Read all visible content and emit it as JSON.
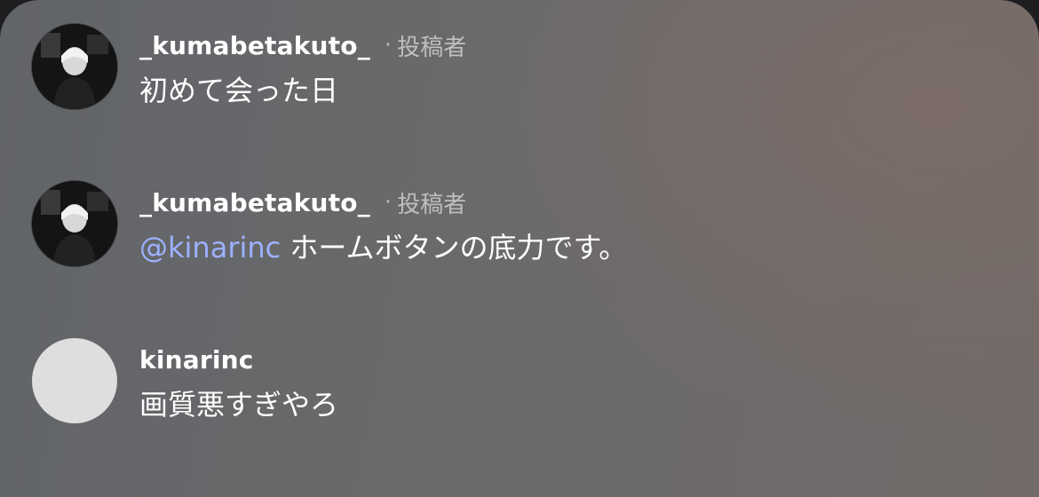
{
  "comments": [
    {
      "username": "_kumabetakuto_",
      "separator": "·",
      "badge": "投稿者",
      "text": "初めて会った日",
      "avatar": "user-photo"
    },
    {
      "username": "_kumabetakuto_",
      "separator": "·",
      "badge": "投稿者",
      "mention": "@kinarinc",
      "text": " ホームボタンの底力です。",
      "avatar": "user-photo"
    },
    {
      "username": "kinarinc",
      "text": "画質悪すぎやろ",
      "avatar": "default-avatar"
    }
  ],
  "colors": {
    "mention": "#9db1ff",
    "text": "#ffffff",
    "badge": "#bfbfbf"
  }
}
